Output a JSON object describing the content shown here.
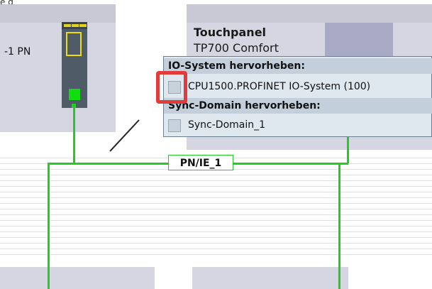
{
  "window": {
    "clipped_title": "e g"
  },
  "devices": {
    "plc": {
      "name_fragment": "-1 PN"
    },
    "touchpanel": {
      "title": "Touchpanel",
      "model": "TP700 Comfort"
    }
  },
  "network": {
    "label": "PN/IE_1"
  },
  "popup": {
    "io_header": "IO-System hervorheben:",
    "io_items": [
      {
        "label": "CPU1500.PROFINET IO-System (100)"
      }
    ],
    "sync_header": "Sync-Domain hervorheben:",
    "sync_items": [
      {
        "label": "Sync-Domain_1"
      }
    ]
  },
  "colors": {
    "network_green": "#22cc22",
    "highlight_red": "#e23b3b",
    "device_bg": "#d6d6e2",
    "popup_bg": "#dfe7ef"
  }
}
